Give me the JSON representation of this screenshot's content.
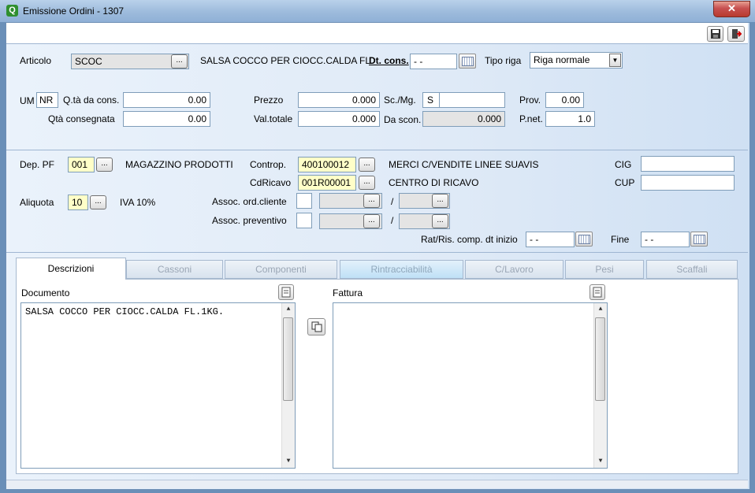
{
  "window": {
    "title": "Emissione Ordini - 1307",
    "close_label": "✕"
  },
  "row1": {
    "articolo_label": "Articolo",
    "articolo_value": "SCOC",
    "articolo_desc": "SALSA COCCO PER CIOCC.CALDA FL",
    "dtcons_label": "Dt. cons.",
    "dtcons_value": "- -",
    "tiporiga_label": "Tipo riga",
    "tiporiga_value": "Riga normale"
  },
  "row2": {
    "um_label": "UM",
    "um_value": "NR",
    "qta_da_cons_label": "Q.tà da cons.",
    "qta_da_cons_value": "0.00",
    "qta_consegnata_label": "Qtà consegnata",
    "qta_consegnata_value": "0.00",
    "prezzo_label": "Prezzo",
    "prezzo_value": "0.000",
    "valtot_label": "Val.totale",
    "valtot_value": "0.000",
    "scmg_label": "Sc./Mg.",
    "scmg_value": "S",
    "scmg_value2": "",
    "dascon_label": "Da scon.",
    "dascon_value": "0.000",
    "prov_label": "Prov.",
    "prov_value": "0.00",
    "pnet_label": "P.net.",
    "pnet_value": "1.0"
  },
  "section2": {
    "deppf_label": "Dep. PF",
    "deppf_value": "001",
    "deppf_desc": "MAGAZZINO PRODOTTI",
    "controp_label": "Controp.",
    "controp_value": "400100012",
    "controp_desc": "MERCI C/VENDITE LINEE SUAVIS",
    "cig_label": "CIG",
    "cig_value": "",
    "cdricavo_label": "CdRicavo",
    "cdricavo_value": "001R00001",
    "cdricavo_desc": "CENTRO DI RICAVO",
    "cup_label": "CUP",
    "cup_value": "",
    "aliquota_label": "Aliquota",
    "aliquota_value": "10",
    "aliquota_desc": "IVA 10%",
    "assoc_ord_label": "Assoc. ord.cliente",
    "assoc_prev_label": "Assoc. preventivo",
    "slash": "/",
    "ratris_label": "Rat/Ris. comp. dt inizio",
    "ratris_value": "- -",
    "fine_label": "Fine",
    "fine_value": "- -"
  },
  "tabs": [
    {
      "label": "Descrizioni"
    },
    {
      "label": "Cassoni"
    },
    {
      "label": "Componenti"
    },
    {
      "label": "Rintracciabilità"
    },
    {
      "label": "C/Lavoro"
    },
    {
      "label": "Pesi"
    },
    {
      "label": "Scaffali"
    }
  ],
  "descrizioni": {
    "documento_label": "Documento",
    "documento_text": "SALSA COCCO PER CIOCC.CALDA FL.1KG.",
    "fattura_label": "Fattura",
    "fattura_text": ""
  },
  "icons": {
    "save": "save-icon",
    "exit": "exit-icon",
    "calendar": "calendar-icon",
    "copy": "copy-icon",
    "notes": "notes-icon"
  },
  "colors": {
    "yellow_field": "#ffffc8",
    "client_bg": "#dfeaf7"
  }
}
